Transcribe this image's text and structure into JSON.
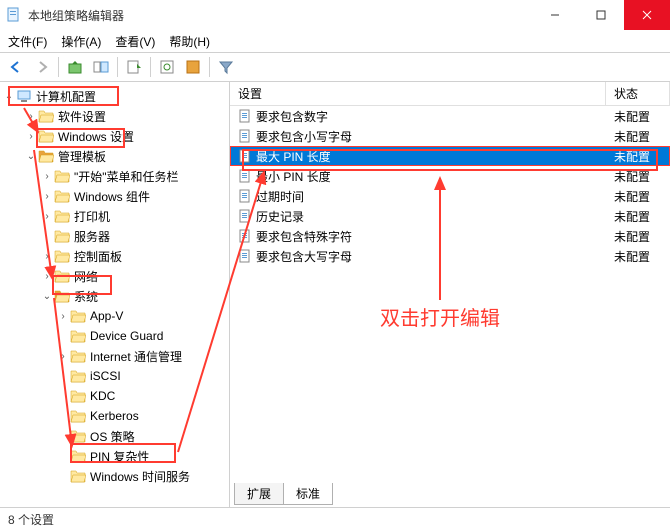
{
  "window": {
    "title": "本地组策略编辑器"
  },
  "menu": {
    "file": "文件(F)",
    "action": "操作(A)",
    "view": "查看(V)",
    "help": "帮助(H)"
  },
  "toolbar_icons": [
    "back",
    "forward",
    "up",
    "show",
    "export",
    "refresh",
    "props",
    "help2",
    "filter"
  ],
  "tree": {
    "root": "计算机配置",
    "items": [
      {
        "indent": 1,
        "exp": ">",
        "label": "软件设置"
      },
      {
        "indent": 1,
        "exp": ">",
        "label": "Windows 设置"
      },
      {
        "indent": 1,
        "exp": "v",
        "label": "管理模板",
        "open": true
      },
      {
        "indent": 2,
        "exp": ">",
        "label": "\"开始\"菜单和任务栏"
      },
      {
        "indent": 2,
        "exp": ">",
        "label": "Windows 组件"
      },
      {
        "indent": 2,
        "exp": ">",
        "label": "打印机"
      },
      {
        "indent": 2,
        "exp": "",
        "label": "服务器"
      },
      {
        "indent": 2,
        "exp": ">",
        "label": "控制面板"
      },
      {
        "indent": 2,
        "exp": ">",
        "label": "网络"
      },
      {
        "indent": 2,
        "exp": "v",
        "label": "系统",
        "open": true
      },
      {
        "indent": 3,
        "exp": ">",
        "label": "App-V"
      },
      {
        "indent": 3,
        "exp": "",
        "label": "Device Guard"
      },
      {
        "indent": 3,
        "exp": ">",
        "label": "Internet 通信管理"
      },
      {
        "indent": 3,
        "exp": "",
        "label": "iSCSI"
      },
      {
        "indent": 3,
        "exp": "",
        "label": "KDC"
      },
      {
        "indent": 3,
        "exp": "",
        "label": "Kerberos"
      },
      {
        "indent": 3,
        "exp": "",
        "label": "OS 策略"
      },
      {
        "indent": 3,
        "exp": "",
        "label": "PIN 复杂性"
      },
      {
        "indent": 3,
        "exp": "",
        "label": "Windows 时间服务"
      }
    ]
  },
  "list": {
    "col_setting": "设置",
    "col_status": "状态",
    "rows": [
      {
        "label": "要求包含数字",
        "status": "未配置"
      },
      {
        "label": "要求包含小写字母",
        "status": "未配置"
      },
      {
        "label": "最大 PIN 长度",
        "status": "未配置",
        "selected": true
      },
      {
        "label": "最小 PIN 长度",
        "status": "未配置"
      },
      {
        "label": "过期时间",
        "status": "未配置"
      },
      {
        "label": "历史记录",
        "status": "未配置"
      },
      {
        "label": "要求包含特殊字符",
        "status": "未配置"
      },
      {
        "label": "要求包含大写字母",
        "status": "未配置"
      }
    ],
    "tab_extended": "扩展",
    "tab_standard": "标准"
  },
  "status": "8 个设置",
  "annotation": {
    "hint": "双击打开编辑"
  }
}
